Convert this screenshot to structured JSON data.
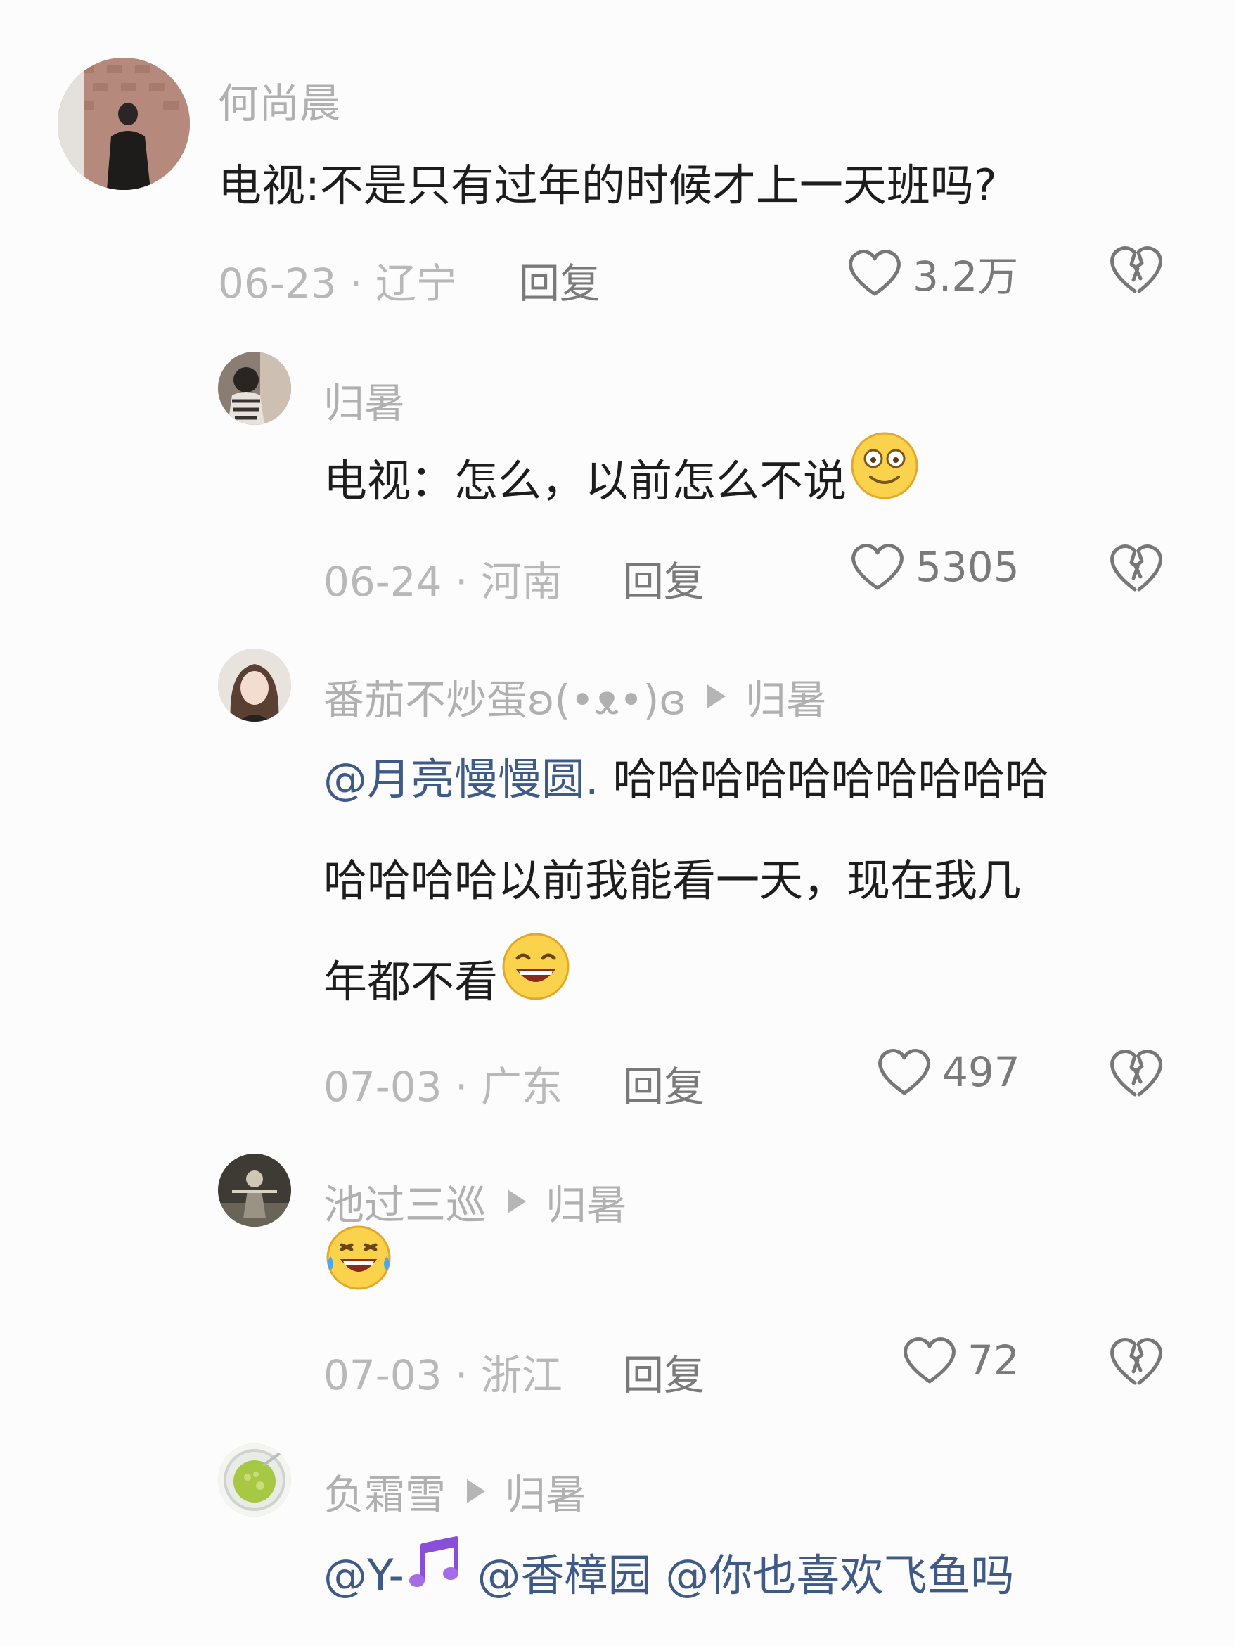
{
  "comments": [
    {
      "name": "何尚晨",
      "text": "电视:不是只有过年的时候才上一天班吗?",
      "date": "06-23",
      "region": "辽宁",
      "reply": "回复",
      "likes": "3.2万"
    },
    {
      "name": "归暑",
      "text": "电视：怎么，以前怎么不说",
      "date": "06-24",
      "region": "河南",
      "reply": "回复",
      "likes": "5305"
    },
    {
      "name": "番茄不炒蛋ʚ(•ᴥ•)ɞ",
      "reply_to": "归暑",
      "mention": "@月亮慢慢圆.",
      "line1": "哈哈哈哈哈哈哈哈哈哈",
      "line2": "哈哈哈哈以前我能看一天，现在我几",
      "line3": "年都不看",
      "date": "07-03",
      "region": "广东",
      "reply": "回复",
      "likes": "497"
    },
    {
      "name": "池过三巡",
      "reply_to": "归暑",
      "date": "07-03",
      "region": "浙江",
      "reply": "回复",
      "likes": "72"
    },
    {
      "name": "负霜雪",
      "reply_to": "归暑",
      "mention1": "@Y-",
      "mention2": "@香樟园",
      "mention3": "@你也喜欢飞鱼吗"
    }
  ],
  "meta_separator": "·",
  "icons": [
    "heart-outline-icon",
    "broken-heart-icon",
    "smile-emoji",
    "grin-emoji",
    "tears-of-joy-emoji",
    "music-notes-emoji"
  ]
}
